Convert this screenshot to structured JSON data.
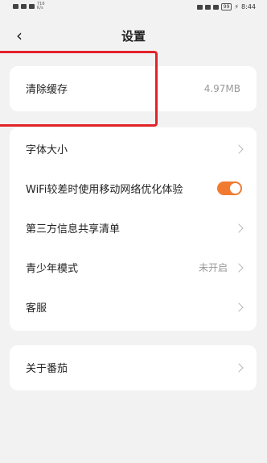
{
  "status_bar": {
    "speed": "716 K/s",
    "battery": "99",
    "time": "8:44"
  },
  "header": {
    "title": "设置"
  },
  "cache": {
    "label": "清除缓存",
    "value": "4.97MB"
  },
  "settings": [
    {
      "label": "字体大小"
    },
    {
      "label": "WiFi较差时使用移动网络优化体验",
      "toggle_on": true
    },
    {
      "label": "第三方信息共享清单"
    },
    {
      "label": "青少年模式",
      "value": "未开启"
    },
    {
      "label": "客服"
    }
  ],
  "about": {
    "label": "关于番茄"
  },
  "colors": {
    "toggle_accent": "#f07a30",
    "highlight_box": "#e3222a"
  }
}
